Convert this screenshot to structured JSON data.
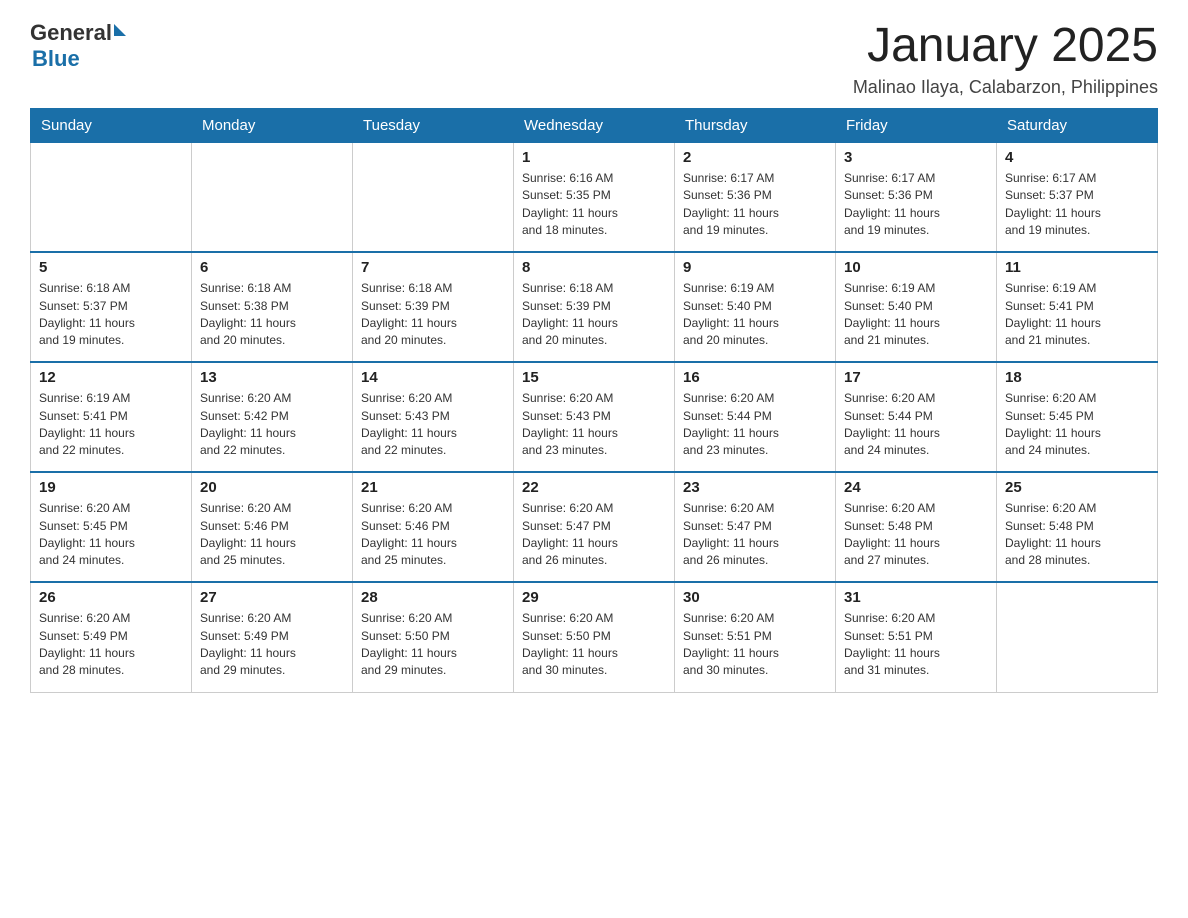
{
  "header": {
    "logo_general": "General",
    "logo_blue": "Blue",
    "month_title": "January 2025",
    "location": "Malinao Ilaya, Calabarzon, Philippines"
  },
  "days_of_week": [
    "Sunday",
    "Monday",
    "Tuesday",
    "Wednesday",
    "Thursday",
    "Friday",
    "Saturday"
  ],
  "weeks": [
    [
      {
        "day": "",
        "info": ""
      },
      {
        "day": "",
        "info": ""
      },
      {
        "day": "",
        "info": ""
      },
      {
        "day": "1",
        "info": "Sunrise: 6:16 AM\nSunset: 5:35 PM\nDaylight: 11 hours\nand 18 minutes."
      },
      {
        "day": "2",
        "info": "Sunrise: 6:17 AM\nSunset: 5:36 PM\nDaylight: 11 hours\nand 19 minutes."
      },
      {
        "day": "3",
        "info": "Sunrise: 6:17 AM\nSunset: 5:36 PM\nDaylight: 11 hours\nand 19 minutes."
      },
      {
        "day": "4",
        "info": "Sunrise: 6:17 AM\nSunset: 5:37 PM\nDaylight: 11 hours\nand 19 minutes."
      }
    ],
    [
      {
        "day": "5",
        "info": "Sunrise: 6:18 AM\nSunset: 5:37 PM\nDaylight: 11 hours\nand 19 minutes."
      },
      {
        "day": "6",
        "info": "Sunrise: 6:18 AM\nSunset: 5:38 PM\nDaylight: 11 hours\nand 20 minutes."
      },
      {
        "day": "7",
        "info": "Sunrise: 6:18 AM\nSunset: 5:39 PM\nDaylight: 11 hours\nand 20 minutes."
      },
      {
        "day": "8",
        "info": "Sunrise: 6:18 AM\nSunset: 5:39 PM\nDaylight: 11 hours\nand 20 minutes."
      },
      {
        "day": "9",
        "info": "Sunrise: 6:19 AM\nSunset: 5:40 PM\nDaylight: 11 hours\nand 20 minutes."
      },
      {
        "day": "10",
        "info": "Sunrise: 6:19 AM\nSunset: 5:40 PM\nDaylight: 11 hours\nand 21 minutes."
      },
      {
        "day": "11",
        "info": "Sunrise: 6:19 AM\nSunset: 5:41 PM\nDaylight: 11 hours\nand 21 minutes."
      }
    ],
    [
      {
        "day": "12",
        "info": "Sunrise: 6:19 AM\nSunset: 5:41 PM\nDaylight: 11 hours\nand 22 minutes."
      },
      {
        "day": "13",
        "info": "Sunrise: 6:20 AM\nSunset: 5:42 PM\nDaylight: 11 hours\nand 22 minutes."
      },
      {
        "day": "14",
        "info": "Sunrise: 6:20 AM\nSunset: 5:43 PM\nDaylight: 11 hours\nand 22 minutes."
      },
      {
        "day": "15",
        "info": "Sunrise: 6:20 AM\nSunset: 5:43 PM\nDaylight: 11 hours\nand 23 minutes."
      },
      {
        "day": "16",
        "info": "Sunrise: 6:20 AM\nSunset: 5:44 PM\nDaylight: 11 hours\nand 23 minutes."
      },
      {
        "day": "17",
        "info": "Sunrise: 6:20 AM\nSunset: 5:44 PM\nDaylight: 11 hours\nand 24 minutes."
      },
      {
        "day": "18",
        "info": "Sunrise: 6:20 AM\nSunset: 5:45 PM\nDaylight: 11 hours\nand 24 minutes."
      }
    ],
    [
      {
        "day": "19",
        "info": "Sunrise: 6:20 AM\nSunset: 5:45 PM\nDaylight: 11 hours\nand 24 minutes."
      },
      {
        "day": "20",
        "info": "Sunrise: 6:20 AM\nSunset: 5:46 PM\nDaylight: 11 hours\nand 25 minutes."
      },
      {
        "day": "21",
        "info": "Sunrise: 6:20 AM\nSunset: 5:46 PM\nDaylight: 11 hours\nand 25 minutes."
      },
      {
        "day": "22",
        "info": "Sunrise: 6:20 AM\nSunset: 5:47 PM\nDaylight: 11 hours\nand 26 minutes."
      },
      {
        "day": "23",
        "info": "Sunrise: 6:20 AM\nSunset: 5:47 PM\nDaylight: 11 hours\nand 26 minutes."
      },
      {
        "day": "24",
        "info": "Sunrise: 6:20 AM\nSunset: 5:48 PM\nDaylight: 11 hours\nand 27 minutes."
      },
      {
        "day": "25",
        "info": "Sunrise: 6:20 AM\nSunset: 5:48 PM\nDaylight: 11 hours\nand 28 minutes."
      }
    ],
    [
      {
        "day": "26",
        "info": "Sunrise: 6:20 AM\nSunset: 5:49 PM\nDaylight: 11 hours\nand 28 minutes."
      },
      {
        "day": "27",
        "info": "Sunrise: 6:20 AM\nSunset: 5:49 PM\nDaylight: 11 hours\nand 29 minutes."
      },
      {
        "day": "28",
        "info": "Sunrise: 6:20 AM\nSunset: 5:50 PM\nDaylight: 11 hours\nand 29 minutes."
      },
      {
        "day": "29",
        "info": "Sunrise: 6:20 AM\nSunset: 5:50 PM\nDaylight: 11 hours\nand 30 minutes."
      },
      {
        "day": "30",
        "info": "Sunrise: 6:20 AM\nSunset: 5:51 PM\nDaylight: 11 hours\nand 30 minutes."
      },
      {
        "day": "31",
        "info": "Sunrise: 6:20 AM\nSunset: 5:51 PM\nDaylight: 11 hours\nand 31 minutes."
      },
      {
        "day": "",
        "info": ""
      }
    ]
  ]
}
